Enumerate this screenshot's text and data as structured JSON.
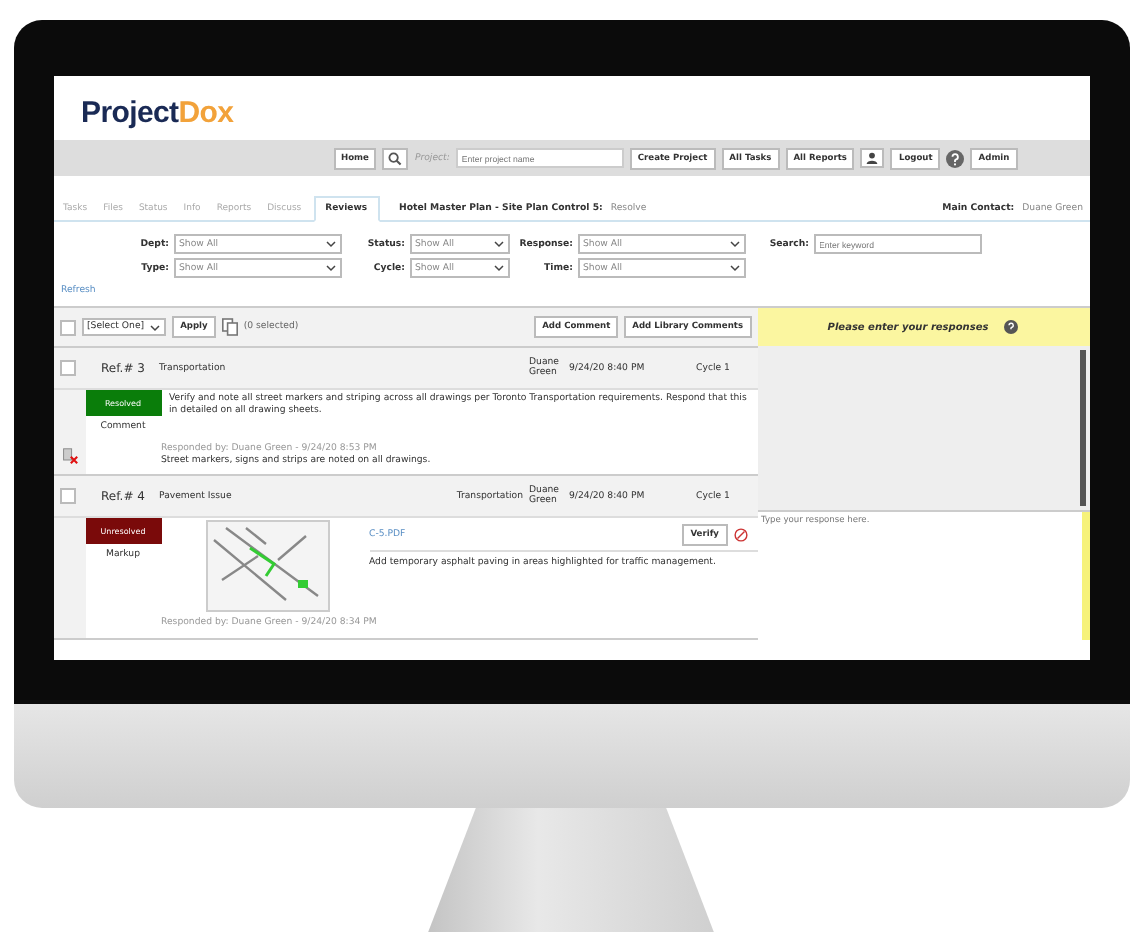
{
  "logo": {
    "primary": "Project",
    "accent": "Dox"
  },
  "nav": {
    "home": "Home",
    "project_label": "Project:",
    "project_placeholder": "Enter project name",
    "buttons": [
      "Create Project",
      "All Tasks",
      "All Reports"
    ],
    "logout": "Logout",
    "admin": "Admin"
  },
  "tabs": [
    {
      "label": "Tasks",
      "selected": false
    },
    {
      "label": "Files",
      "selected": false
    },
    {
      "label": "Status",
      "selected": false
    },
    {
      "label": "Info",
      "selected": false
    },
    {
      "label": "Reports",
      "selected": false
    },
    {
      "label": "Discuss",
      "selected": false
    },
    {
      "label": "Reviews",
      "selected": true
    }
  ],
  "project": {
    "title": "Hotel Master Plan - Site Plan Control 5:",
    "task": "Resolve",
    "contact_label": "Main Contact:",
    "contact": "Duane Green"
  },
  "filters": [
    {
      "label": "Dept:",
      "value": "Show All",
      "kind": "wide"
    },
    {
      "label": "Status:",
      "value": "Show All",
      "kind": "narrow"
    },
    {
      "label": "Response:",
      "value": "Show All",
      "kind": "wide"
    },
    {
      "label": "Search:",
      "placeholder": "Enter keyword",
      "kind": "search"
    },
    {
      "label": "Type:",
      "value": "Show All",
      "kind": "wide"
    },
    {
      "label": "Cycle:",
      "value": "Show All",
      "kind": "narrow"
    },
    {
      "label": "Time:",
      "value": "Show All",
      "kind": "wide"
    }
  ],
  "refresh": "Refresh",
  "toolbar": {
    "checked": false,
    "select": "[Select One]",
    "apply": "Apply",
    "selected_count": "(0 selected)",
    "buttons": [
      "Add Comment",
      "Add Library Comments"
    ],
    "response_header": "Please enter your responses"
  },
  "comments": [
    {
      "checked": false,
      "ref": "Ref.# 3",
      "category": "Transportation",
      "author": "Duane Green",
      "date": "9/24/20 8:40 PM",
      "cycle": "Cycle 1",
      "status": "Resolved",
      "color": "#0a7d0a",
      "type": "Comment",
      "kind": "comment",
      "text": "Verify and note all street markers and striping across all drawings per Toronto Transportation requirements. Respond that this in detailed on all drawing sheets.",
      "responded": "Responded by: Duane Green - 9/24/20 8:53 PM",
      "response": "Street markers, signs and strips are noted on all drawings.",
      "deletable": true
    },
    {
      "checked": false,
      "ref": "Ref.# 4",
      "category": "Pavement Issue",
      "dept": "Transportation",
      "author": "Duane Green",
      "date": "9/24/20 8:40 PM",
      "cycle": "Cycle 1",
      "status": "Unresolved",
      "color": "#7a0a0a",
      "type": "Markup",
      "kind": "markup",
      "file": "C-5.PDF",
      "verify": "Verify",
      "text": "Add temporary asphalt paving in areas highlighted for traffic management.",
      "responded": "Responded by: Duane Green - 9/24/20 8:34 PM",
      "response_placeholder": "Type your response here.",
      "deletable": false
    }
  ]
}
